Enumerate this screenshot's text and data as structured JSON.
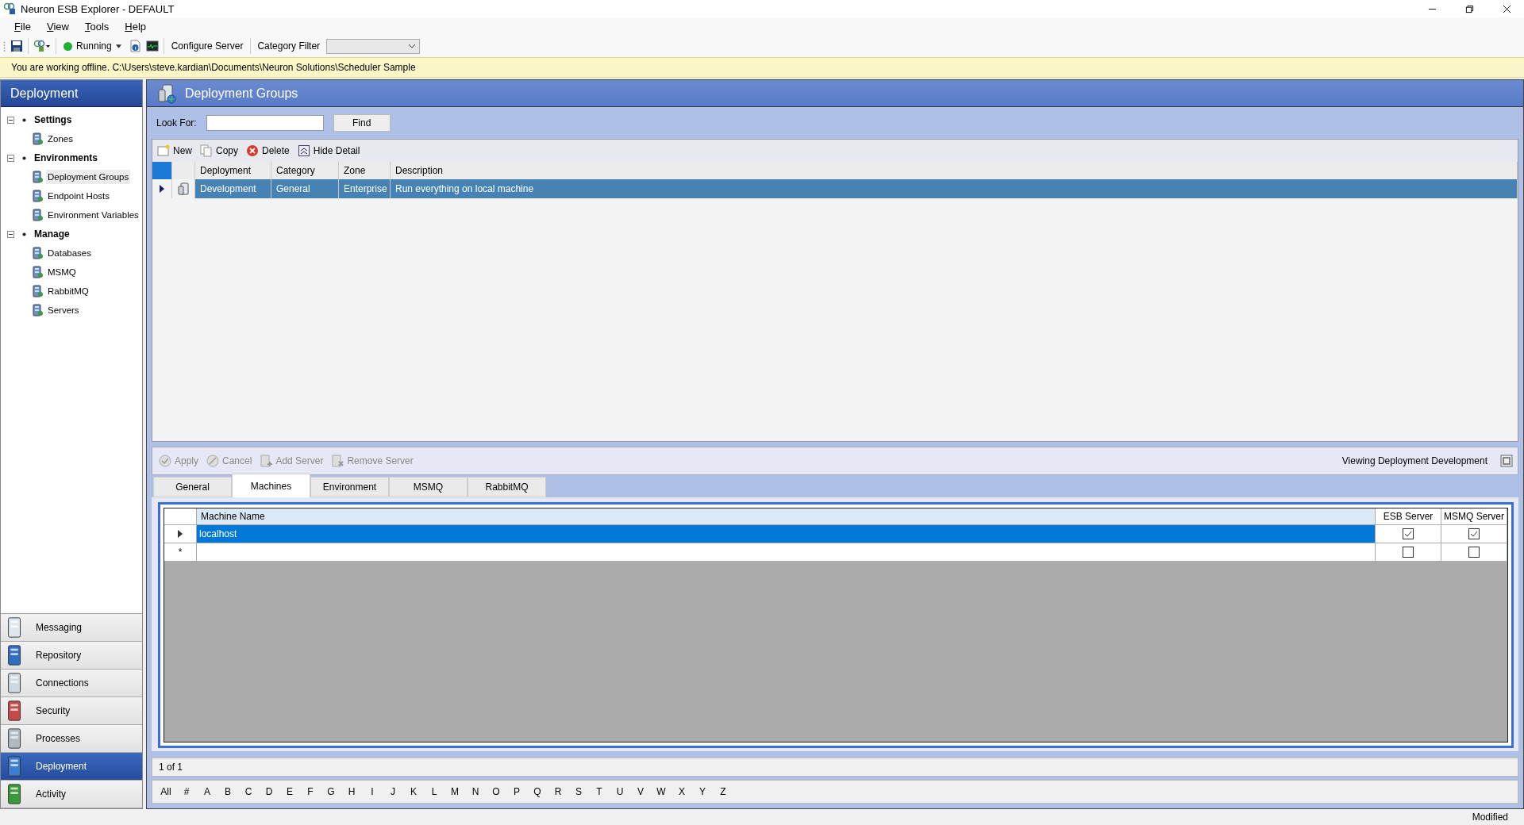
{
  "window": {
    "title": "Neuron ESB Explorer - DEFAULT"
  },
  "menu": [
    "File",
    "View",
    "Tools",
    "Help"
  ],
  "toolbar": {
    "status": {
      "label": "Running",
      "running": true
    },
    "configure_button": "Configure Server",
    "category_filter": {
      "label": "Category Filter"
    }
  },
  "banner": "You are working offline. C:\\Users\\steve.kardian\\Documents\\Neuron Solutions\\Scheduler Sample",
  "sidebar": {
    "title": "Deployment",
    "tree": [
      {
        "label": "Settings",
        "expanded": true,
        "children": [
          {
            "label": "Zones",
            "selected": false
          }
        ]
      },
      {
        "label": "Environments",
        "expanded": true,
        "children": [
          {
            "label": "Deployment Groups",
            "selected": true
          },
          {
            "label": "Endpoint Hosts",
            "selected": false
          },
          {
            "label": "Environment Variables",
            "selected": false
          }
        ]
      },
      {
        "label": "Manage",
        "expanded": true,
        "children": [
          {
            "label": "Databases",
            "selected": false
          },
          {
            "label": "MSMQ",
            "selected": false
          },
          {
            "label": "RabbitMQ",
            "selected": false
          },
          {
            "label": "Servers",
            "selected": false
          }
        ]
      }
    ],
    "nav": [
      {
        "label": "Messaging",
        "selected": false
      },
      {
        "label": "Repository",
        "selected": false
      },
      {
        "label": "Connections",
        "selected": false
      },
      {
        "label": "Security",
        "selected": false
      },
      {
        "label": "Processes",
        "selected": false
      },
      {
        "label": "Deployment",
        "selected": true
      },
      {
        "label": "Activity",
        "selected": false
      }
    ]
  },
  "panel": {
    "title": "Deployment Groups",
    "look_for": {
      "label": "Look For:"
    },
    "find_button": "Find",
    "actions": [
      "New",
      "Copy",
      "Delete",
      "Hide Detail"
    ],
    "table": {
      "columns": [
        "Deployment",
        "Category",
        "Zone",
        "Description"
      ],
      "rows": [
        {
          "cells": [
            "Development",
            "General",
            "Enterprise",
            "Run everything on local machine"
          ],
          "selected": true
        }
      ]
    },
    "detail": {
      "actions": [
        {
          "label": "Apply",
          "disabled": true
        },
        {
          "label": "Cancel",
          "disabled": true
        },
        {
          "label": "Add Server",
          "disabled": true
        },
        {
          "label": "Remove Server",
          "disabled": true
        }
      ],
      "viewing": "Viewing Deployment Development",
      "tabs": [
        {
          "label": "General",
          "selected": false
        },
        {
          "label": "Machines",
          "selected": true
        },
        {
          "label": "Environment",
          "selected": false
        },
        {
          "label": "MSMQ",
          "selected": false
        },
        {
          "label": "RabbitMQ",
          "selected": false
        }
      ],
      "machines": {
        "columns": [
          "Machine Name",
          "ESB Server",
          "MSMQ Server"
        ],
        "rows": [
          {
            "kind": "row",
            "machine_name": "localhost",
            "esb_server": true,
            "msmq_server": true,
            "selected": true
          },
          {
            "kind": "new",
            "marker": "*",
            "esb_server": false,
            "msmq_server": false,
            "selected": false
          }
        ]
      }
    },
    "pager": "1 of 1",
    "alphabet": [
      "All",
      "#",
      "A",
      "B",
      "C",
      "D",
      "E",
      "F",
      "G",
      "H",
      "I",
      "J",
      "K",
      "L",
      "M",
      "N",
      "O",
      "P",
      "Q",
      "R",
      "S",
      "T",
      "U",
      "V",
      "W",
      "X",
      "Y",
      "Z"
    ]
  },
  "status_bar": "Modified"
}
